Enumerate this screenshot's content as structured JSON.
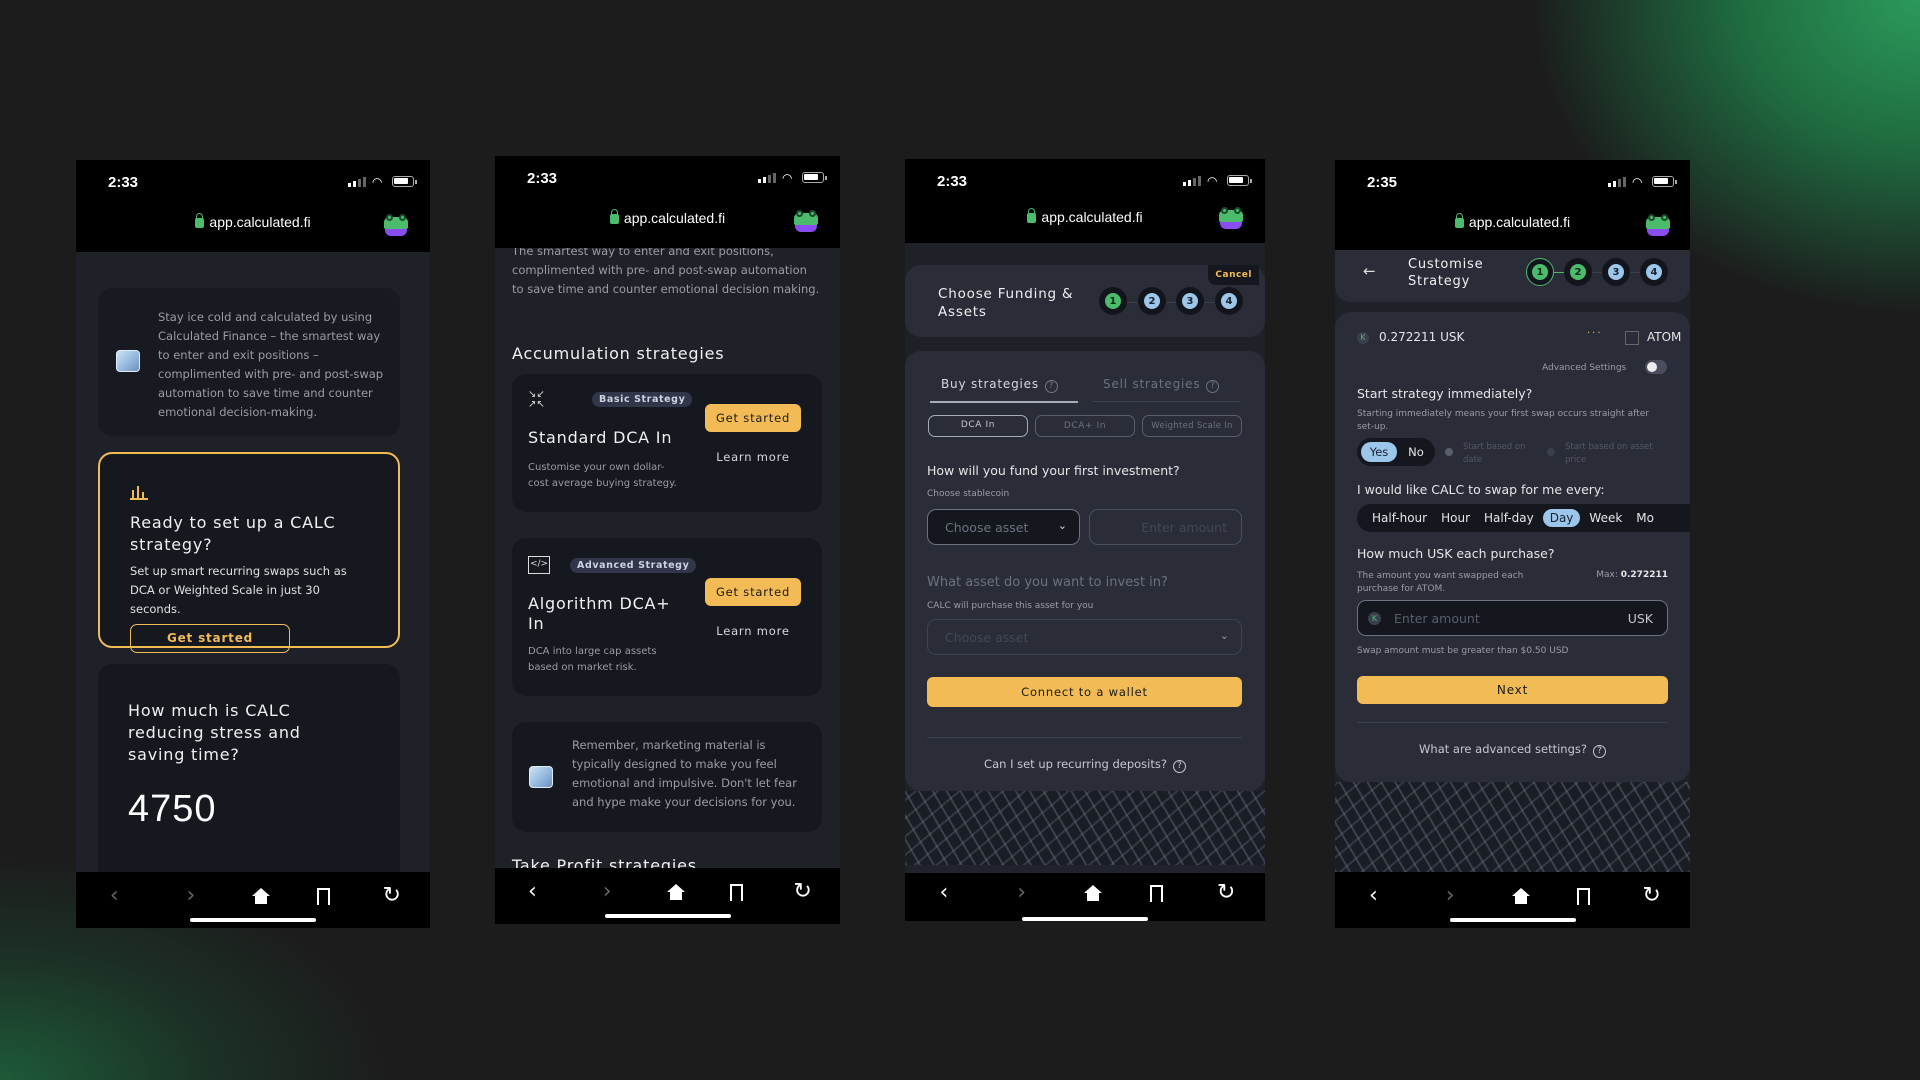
{
  "browser": {
    "url": "app.calculated.fi",
    "nav": {
      "back": "‹",
      "forward": "›",
      "reload": "↻"
    }
  },
  "phones": [
    {
      "time": "2:33",
      "intro_text": "Stay ice cold and calculated by using Calculated Finance – the smartest way to enter and exit positions – complimented with pre- and post-swap automation to save time and counter emotional decision-making.",
      "cta": {
        "title": "Ready to set up a CALC strategy?",
        "text": "Set up smart recurring swaps such as DCA or Weighted Scale in just 30 seconds.",
        "button": "Get started"
      },
      "stats": {
        "title": "How much is CALC reducing stress and saving time?",
        "value": "4750"
      }
    },
    {
      "time": "2:33",
      "intro_text": "The smartest way to enter and exit positions, complimented with pre- and post-swap automation to save time and counter emotional decision making.",
      "section_title": "Accumulation strategies",
      "strategies": [
        {
          "badge": "Basic Strategy",
          "title": "Standard DCA In",
          "description": "Customise your own dollar-cost average buying strategy.",
          "primary": "Get started",
          "secondary": "Learn more"
        },
        {
          "badge": "Advanced Strategy",
          "title": "Algorithm DCA+ In",
          "description": "DCA into large cap assets based on market risk.",
          "primary": "Get started",
          "secondary": "Learn more"
        }
      ],
      "reminder": "Remember, marketing material is typically designed to make you feel emotional and impulsive. Don't let fear and hype make your decisions for you.",
      "next_section": "Take Profit strategies"
    },
    {
      "time": "2:33",
      "cancel": "Cancel",
      "header_title": "Choose Funding & Assets",
      "steps": [
        "1",
        "2",
        "3",
        "4"
      ],
      "current_step": 1,
      "tabs": [
        {
          "label": "Buy strategies",
          "active": true
        },
        {
          "label": "Sell strategies",
          "active": false
        }
      ],
      "strategy_types": [
        "DCA In",
        "DCA+ In",
        "Weighted Scale In"
      ],
      "selected_type": "DCA In",
      "fund_question": "How will you fund your first investment?",
      "stablecoin_label": "Choose stablecoin",
      "stablecoin_placeholder": "Choose asset",
      "amount_placeholder": "Enter amount",
      "invest_question": "What asset do you want to invest in?",
      "invest_hint": "CALC will purchase this asset for you",
      "invest_placeholder": "Choose asset",
      "connect_button": "Connect to a wallet",
      "faq": "Can I set up recurring deposits?"
    },
    {
      "time": "2:35",
      "header_title": "Customise Strategy",
      "back": "←",
      "steps": [
        "1",
        "2",
        "3",
        "4"
      ],
      "current_step": 2,
      "from_amount": "0.272211 USK",
      "to_asset": "ATOM",
      "advanced_settings_label": "Advanced Settings",
      "advanced_settings_on": false,
      "start_question": "Start strategy immediately?",
      "start_hint": "Starting immediately means your first swap occurs straight after set-up.",
      "yes": "Yes",
      "no": "No",
      "start_selected": "Yes",
      "start_date_option": "Start based on date",
      "start_price_option": "Start based on asset price",
      "interval_question": "I would like CALC to swap for me every:",
      "intervals": [
        "Half-hour",
        "Hour",
        "Half-day",
        "Day",
        "Week",
        "Mo"
      ],
      "selected_interval": "Day",
      "amount_question": "How much USK each purchase?",
      "amount_hint": "The amount you want swapped each purchase for ATOM.",
      "max_label": "Max:",
      "max_value": "0.272211",
      "amount_placeholder": "Enter amount",
      "amount_unit": "USK",
      "amount_warning": "Swap amount must be greater than $0.50 USD",
      "next_button": "Next",
      "faq": "What are advanced settings?"
    }
  ],
  "colors": {
    "accent_gold": "#f2bb55",
    "accent_green": "#4cbb6c",
    "step_blue": "#9cc7ea",
    "brand_purple": "#8a4df0"
  }
}
